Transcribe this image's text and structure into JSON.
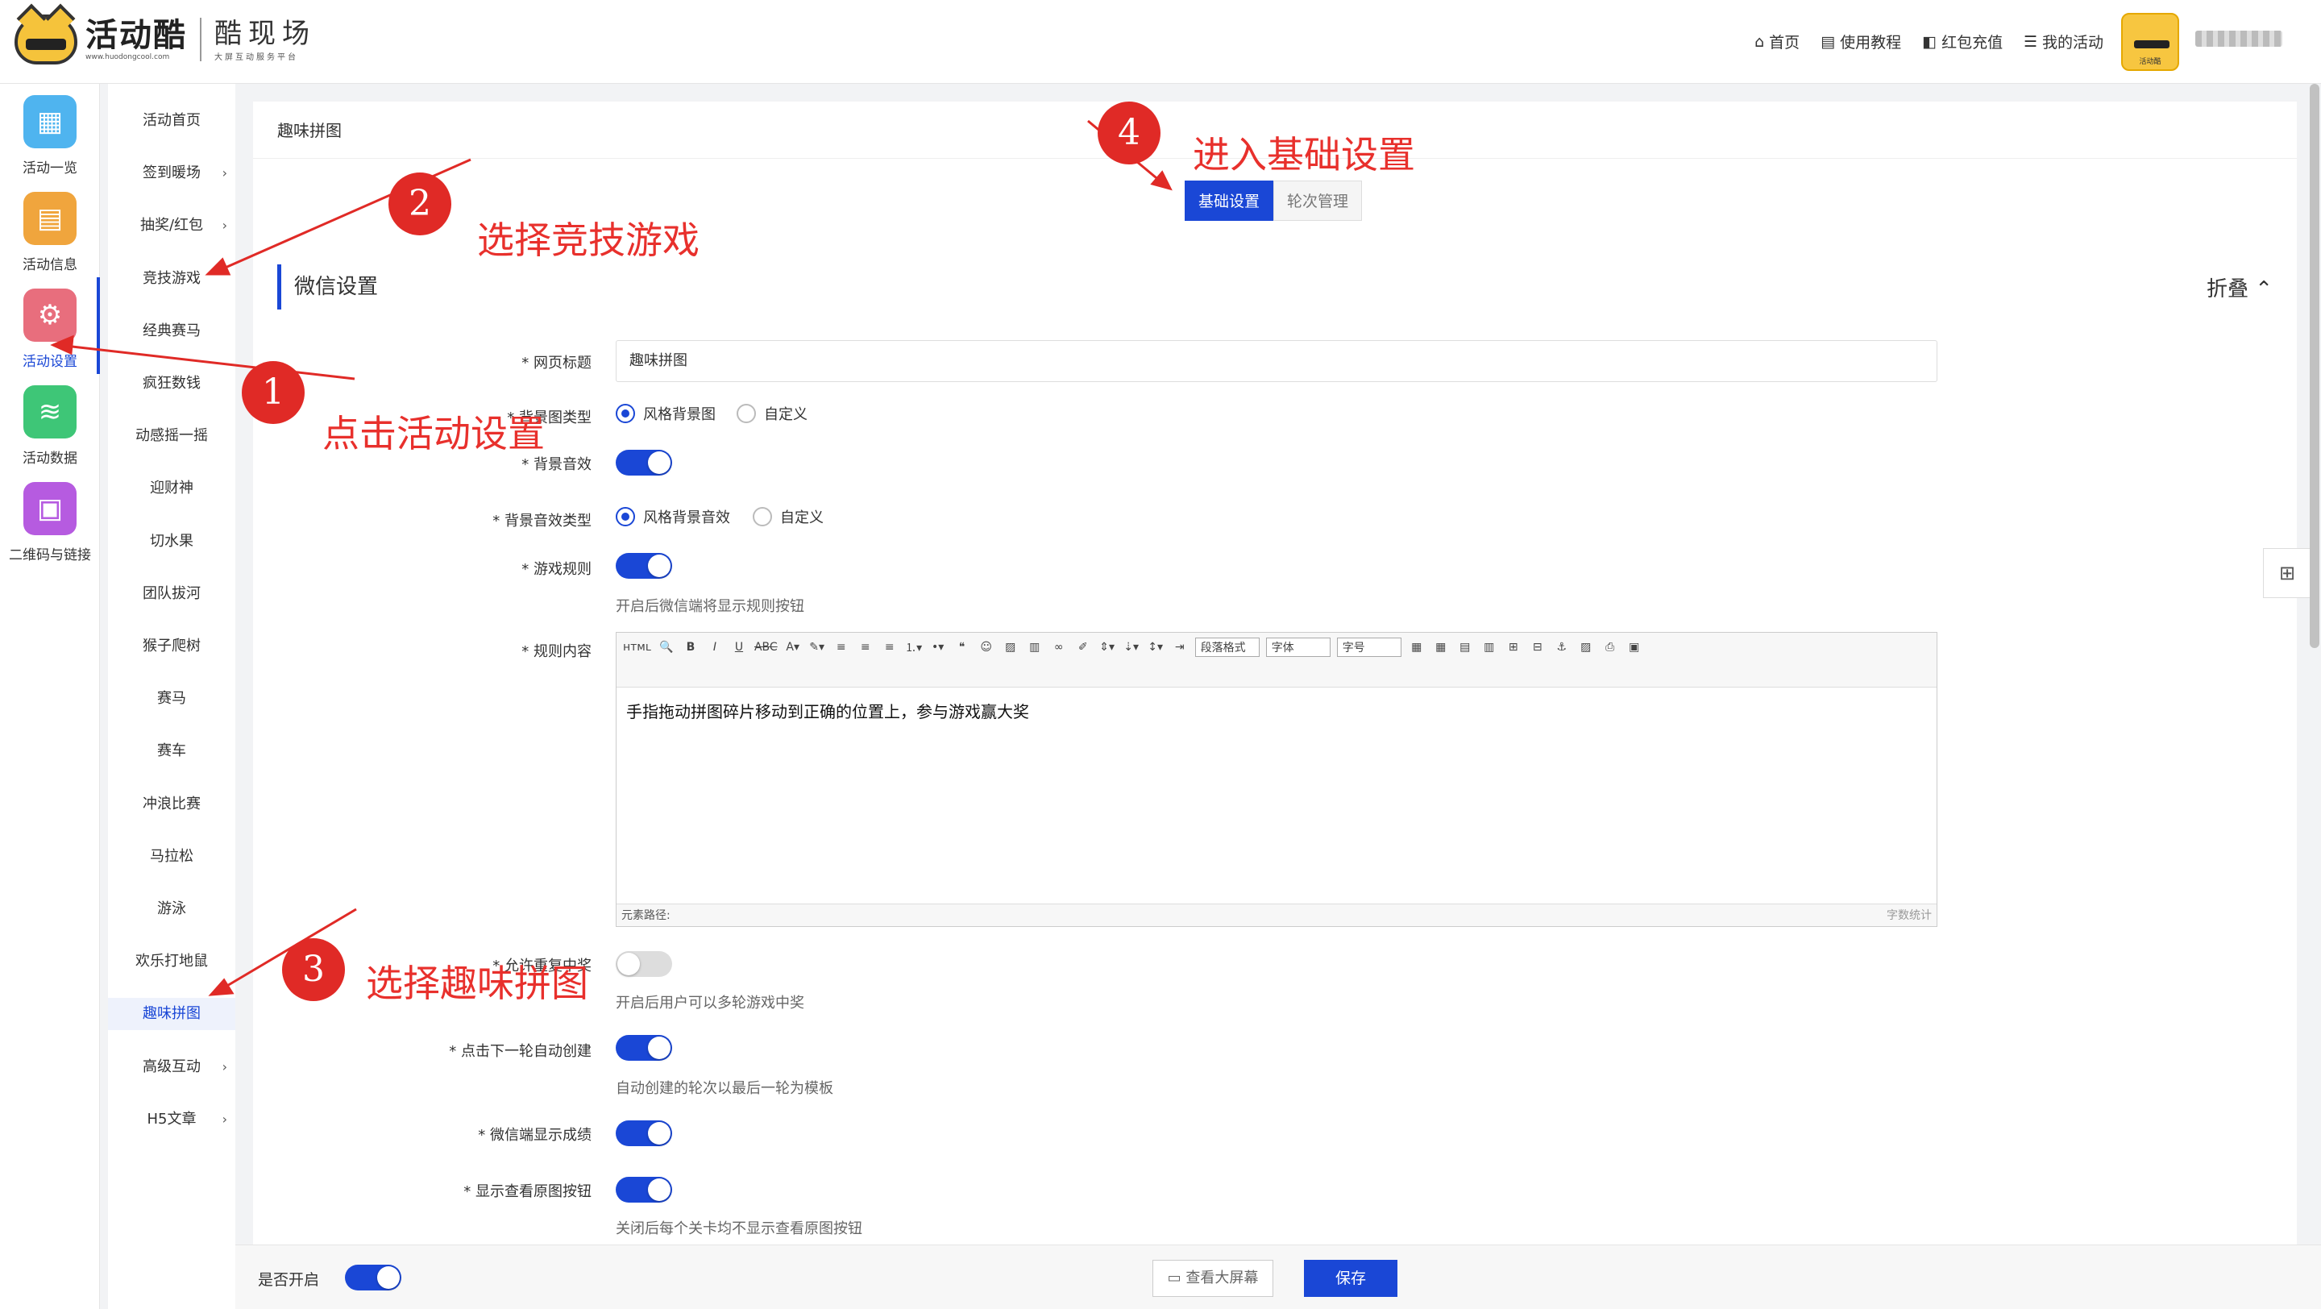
{
  "header": {
    "logo_text": "活动酷",
    "logo_url": "www.huodongcool.com",
    "sub_title": "酷现场",
    "sub_slogan": "大屏互动服务平台",
    "nav": [
      {
        "icon": "home-icon",
        "label": "首页"
      },
      {
        "icon": "book-icon",
        "label": "使用教程"
      },
      {
        "icon": "redpacket-icon",
        "label": "红包充值"
      },
      {
        "icon": "list-icon",
        "label": "我的活动"
      }
    ],
    "avatar_text": "活动酷"
  },
  "sidebar": [
    {
      "label": "活动一览",
      "icon": "grid-icon",
      "color": "#4fb4ef"
    },
    {
      "label": "活动信息",
      "icon": "document-icon",
      "color": "#f0a53d"
    },
    {
      "label": "活动设置",
      "icon": "gear-icon",
      "color": "#e86e7d"
    },
    {
      "label": "活动数据",
      "icon": "database-icon",
      "color": "#3ec677"
    },
    {
      "label": "二维码与链接",
      "icon": "qrcode-icon",
      "color": "#b65be0"
    }
  ],
  "submenu": [
    {
      "label": "活动首页",
      "chev": ""
    },
    {
      "label": "签到暖场",
      "chev": "›"
    },
    {
      "label": "抽奖/红包",
      "chev": "›"
    },
    {
      "label": "竞技游戏",
      "chev": ""
    },
    {
      "label": "经典赛马",
      "chev": ""
    },
    {
      "label": "疯狂数钱",
      "chev": ""
    },
    {
      "label": "动感摇一摇",
      "chev": ""
    },
    {
      "label": "迎财神",
      "chev": ""
    },
    {
      "label": "切水果",
      "chev": ""
    },
    {
      "label": "团队拔河",
      "chev": ""
    },
    {
      "label": "猴子爬树",
      "chev": ""
    },
    {
      "label": "赛马",
      "chev": ""
    },
    {
      "label": "赛车",
      "chev": ""
    },
    {
      "label": "冲浪比赛",
      "chev": ""
    },
    {
      "label": "马拉松",
      "chev": ""
    },
    {
      "label": "游泳",
      "chev": ""
    },
    {
      "label": "欢乐打地鼠",
      "chev": ""
    },
    {
      "label": "趣味拼图",
      "chev": ""
    },
    {
      "label": "高级互动",
      "chev": "›"
    },
    {
      "label": "H5文章",
      "chev": "›"
    }
  ],
  "main": {
    "title": "趣味拼图",
    "tabs": [
      "基础设置",
      "轮次管理"
    ],
    "section": "微信设置",
    "fold": "折叠 ⌃",
    "fields": {
      "page_title_label": "网页标题",
      "page_title_value": "趣味拼图",
      "bg_type_label": "背景图类型",
      "bg_type_opt1": "风格背景图",
      "bg_type_opt2": "自定义",
      "bg_sound_label": "背景音效",
      "bg_sound_type_label": "背景音效类型",
      "bg_sound_opt1": "风格背景音效",
      "bg_sound_opt2": "自定义",
      "rules_label": "游戏规则",
      "rules_hint": "开启后微信端将显示规则按钮",
      "rules_content_label": "规则内容",
      "rules_content": "手指拖动拼图碎片移动到正确的位置上，参与游戏赢大奖",
      "editor_path": "元素路径:",
      "editor_count": "字数统计",
      "editor_format": "段落格式",
      "editor_font": "字体",
      "editor_size": "字号",
      "repeat_label": "允许重复中奖",
      "repeat_hint": "开启后用户可以多轮游戏中奖",
      "auto_label": "点击下一轮自动创建",
      "auto_hint": "自动创建的轮次以最后一轮为模板",
      "score_label": "微信端显示成绩",
      "orig_label": "显示查看原图按钮",
      "orig_hint": "关闭后每个关卡均不显示查看原图按钮"
    }
  },
  "bottom": {
    "enabled_label": "是否开启",
    "screen_btn": "查看大屏幕",
    "save_btn": "保存"
  },
  "annotations": [
    {
      "num": "1",
      "text": "点击活动设置"
    },
    {
      "num": "2",
      "text": "选择竞技游戏"
    },
    {
      "num": "3",
      "text": "选择趣味拼图"
    },
    {
      "num": "4",
      "text": "进入基础设置"
    }
  ],
  "colors": {
    "primary": "#1a47d6",
    "annotation": "#e02a26"
  }
}
